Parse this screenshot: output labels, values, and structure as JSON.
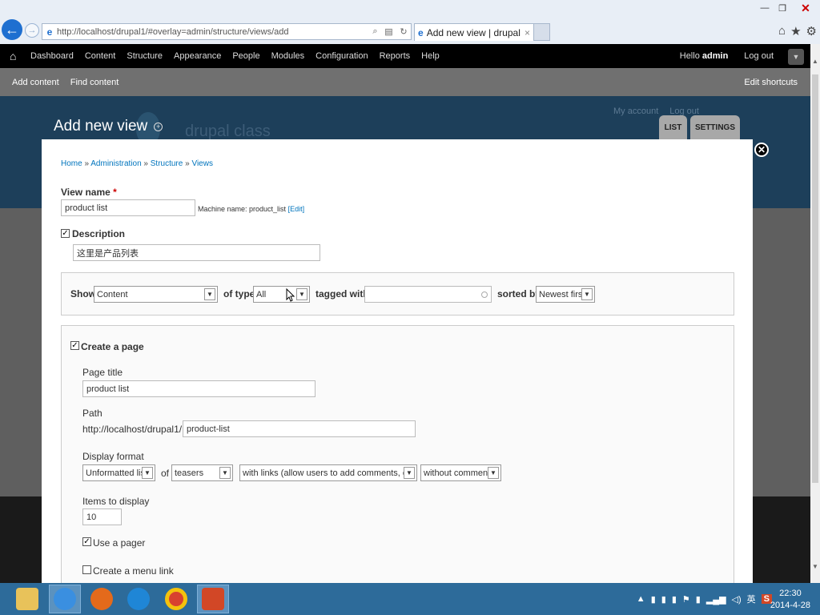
{
  "browser": {
    "url": "http://localhost/drupal1/#overlay=admin/structure/views/add",
    "tab_title": "Add new view | drupal cl...",
    "tab_close": "×"
  },
  "toolbar": {
    "menu": [
      "Dashboard",
      "Content",
      "Structure",
      "Appearance",
      "People",
      "Modules",
      "Configuration",
      "Reports",
      "Help"
    ],
    "hello": "Hello",
    "username": "admin",
    "logout": "Log out"
  },
  "shortcuts": {
    "items": [
      "Add content",
      "Find content"
    ],
    "edit": "Edit shortcuts"
  },
  "background": {
    "site_name": "drupal class",
    "links": [
      "My account",
      "Log out"
    ]
  },
  "overlay": {
    "title": "Add new view",
    "tabs": [
      "LIST",
      "SETTINGS"
    ]
  },
  "breadcrumb": [
    "Home",
    "Administration",
    "Structure",
    "Views"
  ],
  "breadcrumb_sep": "»",
  "form": {
    "view_name_label": "View name",
    "required_mark": "*",
    "view_name_value": "product list",
    "machine_name_prefix": "Machine name: product_list",
    "machine_name_edit": "[Edit]",
    "description_label": "Description",
    "description_value": "这里是产品列表",
    "show_label": "Show",
    "show_value": "Content",
    "of_type_label": "of type",
    "of_type_value": "All",
    "tagged_with_label": "tagged with",
    "tagged_with_value": "",
    "sorted_by_label": "sorted by",
    "sorted_by_value": "Newest first",
    "create_page_label": "Create a page",
    "page_title_label": "Page title",
    "page_title_value": "product list",
    "path_label": "Path",
    "path_prefix": "http://localhost/drupal1/",
    "path_value": "product-list",
    "display_format_label": "Display format",
    "display_format_value": "Unformatted list",
    "of_label": "of",
    "teasers_value": "teasers",
    "links_value": "with links (allow users to add comments, etc.)",
    "comments_value": "without comments",
    "items_label": "Items to display",
    "items_value": "10",
    "use_pager_label": "Use a pager",
    "menu_link_label": "Create a menu link"
  },
  "checkmark": "✓",
  "clock": {
    "time": "22:30",
    "date": "2014-4-28"
  }
}
